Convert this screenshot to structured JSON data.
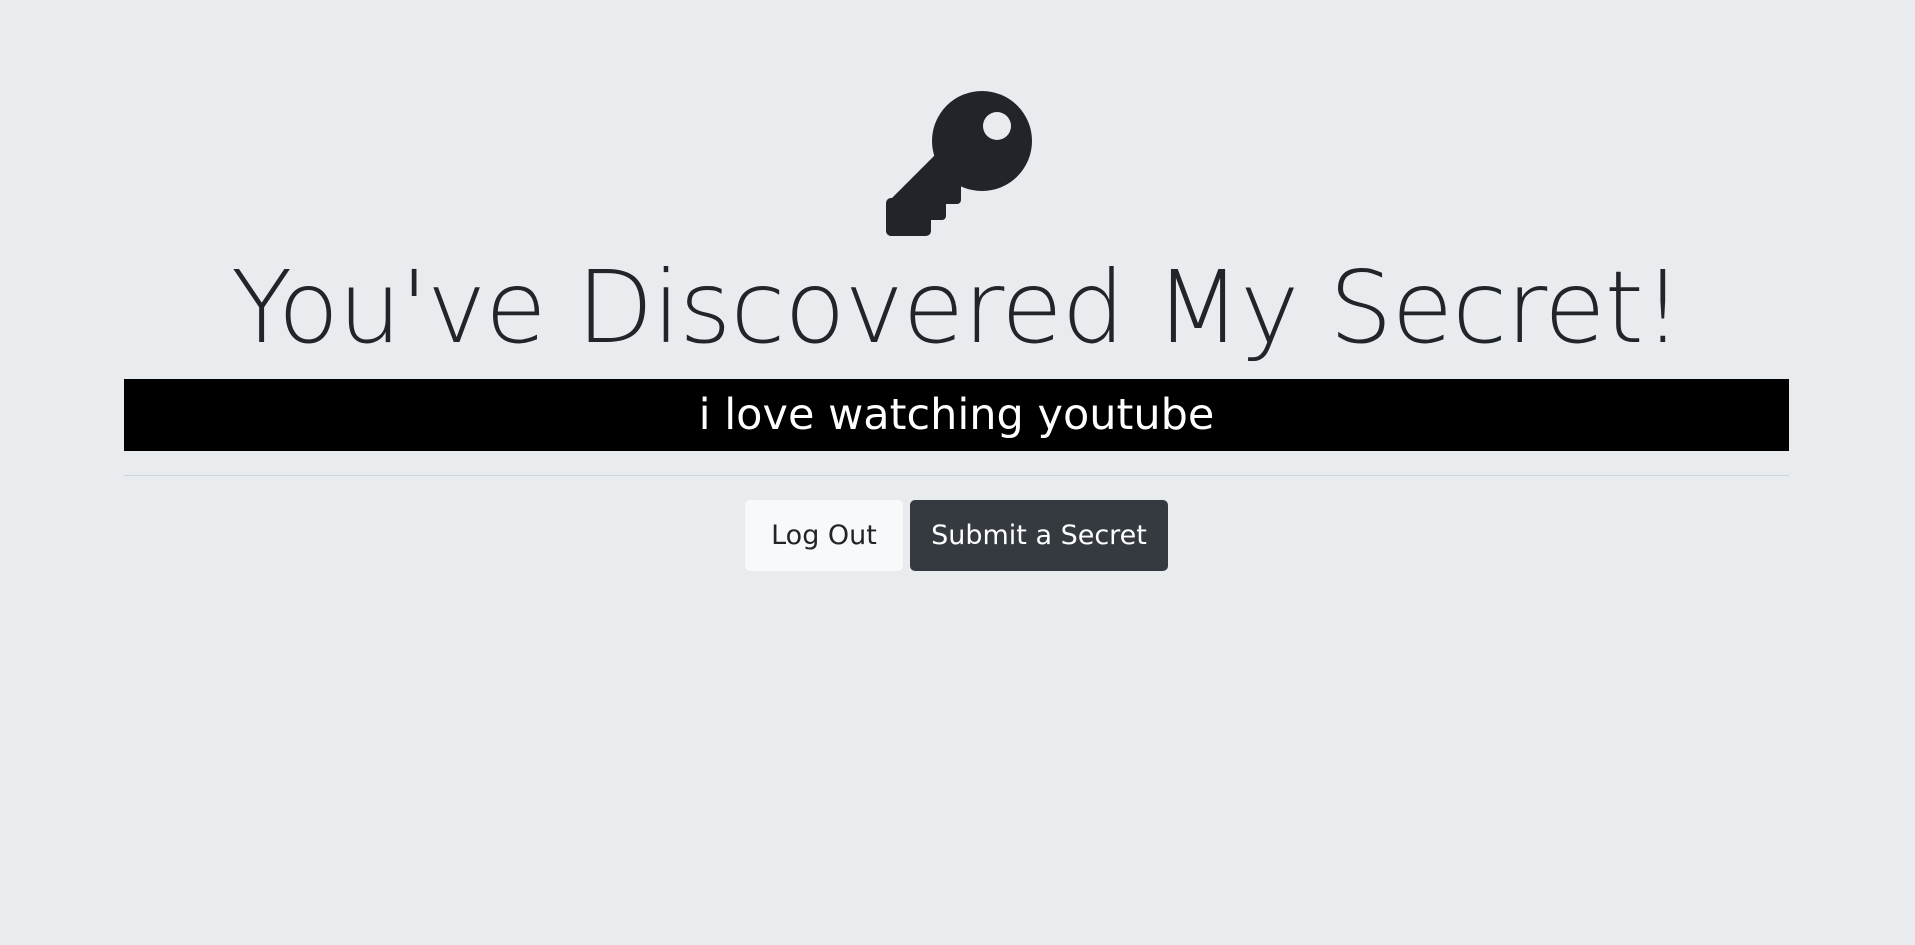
{
  "header": {
    "icon": "key-icon",
    "title": "You've Discovered My Secret!"
  },
  "secret": {
    "text": "i love watching youtube"
  },
  "actions": {
    "logout_label": "Log Out",
    "submit_label": "Submit a Secret"
  },
  "colors": {
    "page_background": "#e9ecef",
    "text": "#212529",
    "secret_background": "#000000",
    "secret_text": "#ffffff",
    "light_button": "#f8f9fa",
    "dark_button": "#343a40"
  }
}
